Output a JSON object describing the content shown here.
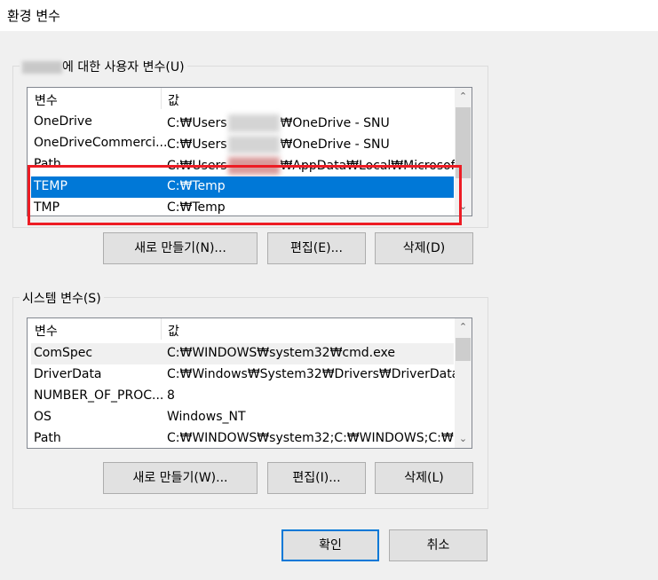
{
  "window": {
    "title": "환경 변수"
  },
  "user_section": {
    "label": "에 대한 사용자 변수(U)",
    "columns": [
      "변수",
      "값"
    ],
    "rows": [
      {
        "name": "OneDrive",
        "value_prefix": "C:₩Users",
        "value_suffix": "₩OneDrive - SNU"
      },
      {
        "name": "OneDriveCommerci...",
        "value_prefix": "C:₩Users",
        "value_suffix": "₩OneDrive - SNU"
      },
      {
        "name": "Path",
        "value_prefix": "C:₩Users",
        "value_suffix": "₩AppData₩Local₩Microsoft..."
      },
      {
        "name": "TEMP",
        "value": "C:₩Temp"
      },
      {
        "name": "TMP",
        "value": "C:₩Temp"
      }
    ],
    "buttons": {
      "new": "새로 만들기(N)...",
      "edit": "편집(E)...",
      "delete": "삭제(D)"
    }
  },
  "system_section": {
    "label": "시스템 변수(S)",
    "columns": [
      "변수",
      "값"
    ],
    "rows": [
      {
        "name": "ComSpec",
        "value": "C:₩WINDOWS₩system32₩cmd.exe"
      },
      {
        "name": "DriverData",
        "value": "C:₩Windows₩System32₩Drivers₩DriverData"
      },
      {
        "name": "NUMBER_OF_PROC...",
        "value": "8"
      },
      {
        "name": "OS",
        "value": "Windows_NT"
      },
      {
        "name": "Path",
        "value": "C:₩WINDOWS₩system32;C:₩WINDOWS;C:₩..."
      }
    ],
    "buttons": {
      "new": "새로 만들기(W)...",
      "edit": "편집(I)...",
      "delete": "삭제(L)"
    }
  },
  "footer": {
    "ok": "확인",
    "cancel": "취소"
  },
  "colors": {
    "selection": "#0078d7",
    "highlight": "#ed1c24"
  }
}
